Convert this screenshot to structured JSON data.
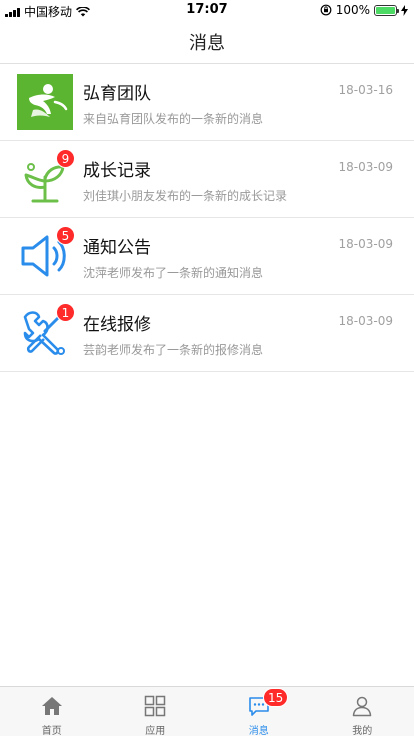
{
  "status_bar": {
    "carrier": "中国移动",
    "time": "17:07",
    "battery": "100%"
  },
  "nav": {
    "title": "消息"
  },
  "messages": [
    {
      "title": "弘育团队",
      "desc": "来自弘育团队发布的一条新的消息",
      "date": "18-03-16",
      "badge": "",
      "icon": "team-logo-icon"
    },
    {
      "title": "成长记录",
      "desc": "刘佳琪小朋友发布的一条新的成长记录",
      "date": "18-03-09",
      "badge": "9",
      "icon": "sprout-icon"
    },
    {
      "title": "通知公告",
      "desc": "沈萍老师发布了一条新的通知消息",
      "date": "18-03-09",
      "badge": "5",
      "icon": "speaker-icon"
    },
    {
      "title": "在线报修",
      "desc": "芸韵老师发布了一条新的报修消息",
      "date": "18-03-09",
      "badge": "1",
      "icon": "repair-tools-icon"
    }
  ],
  "tabs": [
    {
      "label": "首页",
      "icon": "home-icon",
      "active": false,
      "badge": ""
    },
    {
      "label": "应用",
      "icon": "apps-grid-icon",
      "active": false,
      "badge": ""
    },
    {
      "label": "消息",
      "icon": "chat-icon",
      "active": true,
      "badge": "15"
    },
    {
      "label": "我的",
      "icon": "user-icon",
      "active": false,
      "badge": ""
    }
  ],
  "colors": {
    "accent": "#2a8ceb",
    "badge": "#ff2a2a",
    "green": "#6cc04a"
  }
}
